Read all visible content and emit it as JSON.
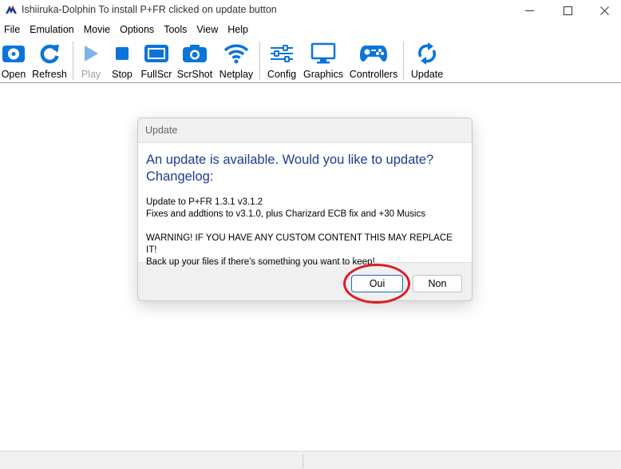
{
  "window": {
    "title": "Ishiiruka-Dolphin  To install P+FR clicked on update button",
    "app_icon": "dolphin-logo-icon",
    "controls": [
      "minimize-icon",
      "maximize-icon",
      "close-icon"
    ]
  },
  "menubar": {
    "items": [
      "File",
      "Emulation",
      "Movie",
      "Options",
      "Tools",
      "View",
      "Help"
    ]
  },
  "toolbar": {
    "items": [
      {
        "label": "Open",
        "icon": "open-disc-icon",
        "enabled": true
      },
      {
        "label": "Refresh",
        "icon": "refresh-icon",
        "enabled": true
      },
      {
        "label": "Play",
        "icon": "play-icon",
        "enabled": false
      },
      {
        "label": "Stop",
        "icon": "stop-icon",
        "enabled": true
      },
      {
        "label": "FullScr",
        "icon": "fullscreen-icon",
        "enabled": true
      },
      {
        "label": "ScrShot",
        "icon": "camera-icon",
        "enabled": true
      },
      {
        "label": "Netplay",
        "icon": "wifi-icon",
        "enabled": true
      },
      {
        "label": "Config",
        "icon": "sliders-icon",
        "enabled": true
      },
      {
        "label": "Graphics",
        "icon": "monitor-icon",
        "enabled": true
      },
      {
        "label": "Controllers",
        "icon": "gamepad-icon",
        "enabled": true
      },
      {
        "label": "Update",
        "icon": "sync-icon",
        "enabled": true
      }
    ],
    "accent_color": "#0a74da"
  },
  "dialog": {
    "title": "Update",
    "heading_line1": "An update is available. Would you like to update?",
    "heading_line2": "Changelog:",
    "body": [
      "Update to P+FR 1.3.1 v3.1.2",
      "Fixes and addtions to v3.1.0, plus Charizard ECB fix and +30 Musics",
      "WARNING! IF YOU HAVE ANY CUSTOM CONTENT THIS MAY REPLACE IT!",
      "Back up your files if there's something you want to keep!"
    ],
    "buttons": {
      "yes": "Oui",
      "no": "Non"
    },
    "heading_color": "#1f3a93",
    "annotation_color": "#e01b24"
  }
}
